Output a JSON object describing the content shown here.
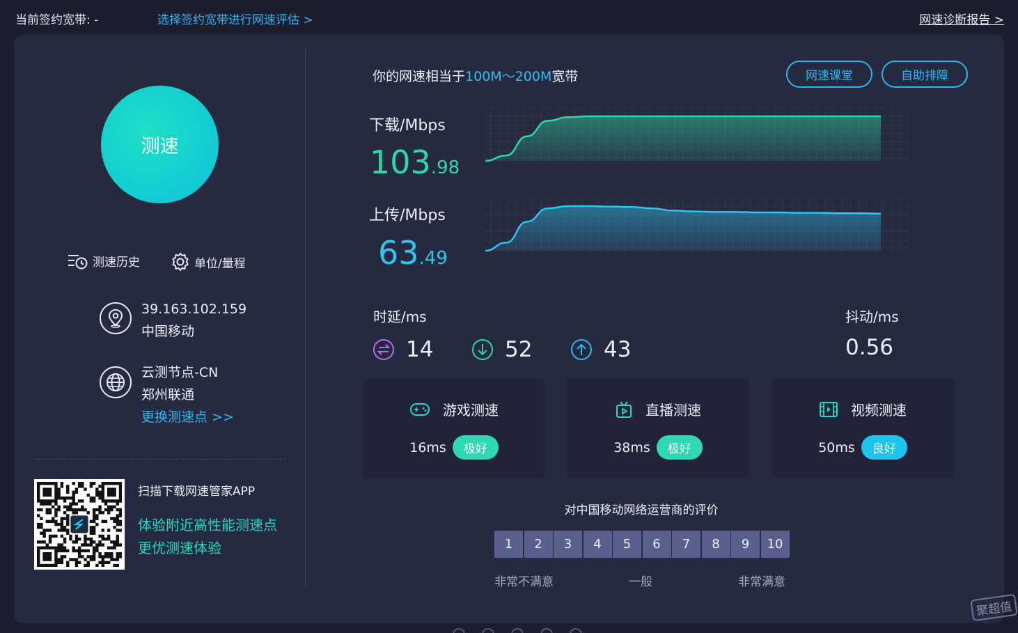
{
  "topbar": {
    "contract_label": "当前签约宽带: -",
    "select_link": "选择签约宽带进行网速评估 >",
    "report_link": "网速诊断报告 >"
  },
  "left": {
    "speed_button": "测速",
    "history": "测速历史",
    "unit": "单位/量程",
    "ip": "39.163.102.159",
    "isp": "中国移动",
    "node": "云测节点-CN",
    "node_isp": "郑州联通",
    "change_node": "更换测速点 >>",
    "app_title": "扫描下载网速管家APP",
    "app_line1": "体验附近高性能测速点",
    "app_line2": "更优测速体验"
  },
  "summary": {
    "prefix": "你的网速相当于",
    "range": "100M～200M",
    "suffix": "宽带",
    "btn_class": "网速课堂",
    "btn_self": "自助排障"
  },
  "download": {
    "label": "下载/Mbps",
    "int": "103",
    "dec": ".98"
  },
  "upload": {
    "label": "上传/Mbps",
    "int": "63",
    "dec": ".49"
  },
  "latency": {
    "title": "时延/ms",
    "idle": "14",
    "down": "52",
    "up": "43"
  },
  "jitter": {
    "title": "抖动/ms",
    "value": "0.56"
  },
  "cards": [
    {
      "title": "游戏测速",
      "value": "16ms",
      "badge": "极好",
      "badge_color": "#2ed8b0"
    },
    {
      "title": "直播测速",
      "value": "38ms",
      "badge": "极好",
      "badge_color": "#2ed8b0"
    },
    {
      "title": "视频测速",
      "value": "50ms",
      "badge": "良好",
      "badge_color": "#1cc4ee"
    }
  ],
  "rating": {
    "title": "对中国移动网络运营商的评价",
    "scores": [
      "1",
      "2",
      "3",
      "4",
      "5",
      "6",
      "7",
      "8",
      "9",
      "10"
    ],
    "low": "非常不满意",
    "mid": "一般",
    "high": "非常满意"
  },
  "watermark": "聚超值",
  "colors": {
    "accent": "#2fb6f0",
    "download": "#2ed8a6",
    "upload": "#2fc4f2",
    "panel": "#262a40"
  },
  "chart_data": [
    {
      "type": "area",
      "series": [
        {
          "values": [
            0,
            0.12,
            0.55,
            0.9,
            0.98,
            1.0,
            1.0,
            1.0,
            1.0,
            1.0,
            1.0,
            1.0,
            1.0,
            1.0,
            1.0,
            1.0,
            1.0,
            1.0,
            1.0,
            1.0
          ]
        }
      ]
    },
    {
      "type": "area",
      "series": [
        {
          "values": [
            0,
            0.18,
            0.65,
            0.95,
            1.0,
            1.0,
            0.99,
            0.98,
            0.95,
            0.9,
            0.88,
            0.87,
            0.87,
            0.86,
            0.86,
            0.85,
            0.85,
            0.84,
            0.84,
            0.83
          ]
        }
      ]
    }
  ]
}
